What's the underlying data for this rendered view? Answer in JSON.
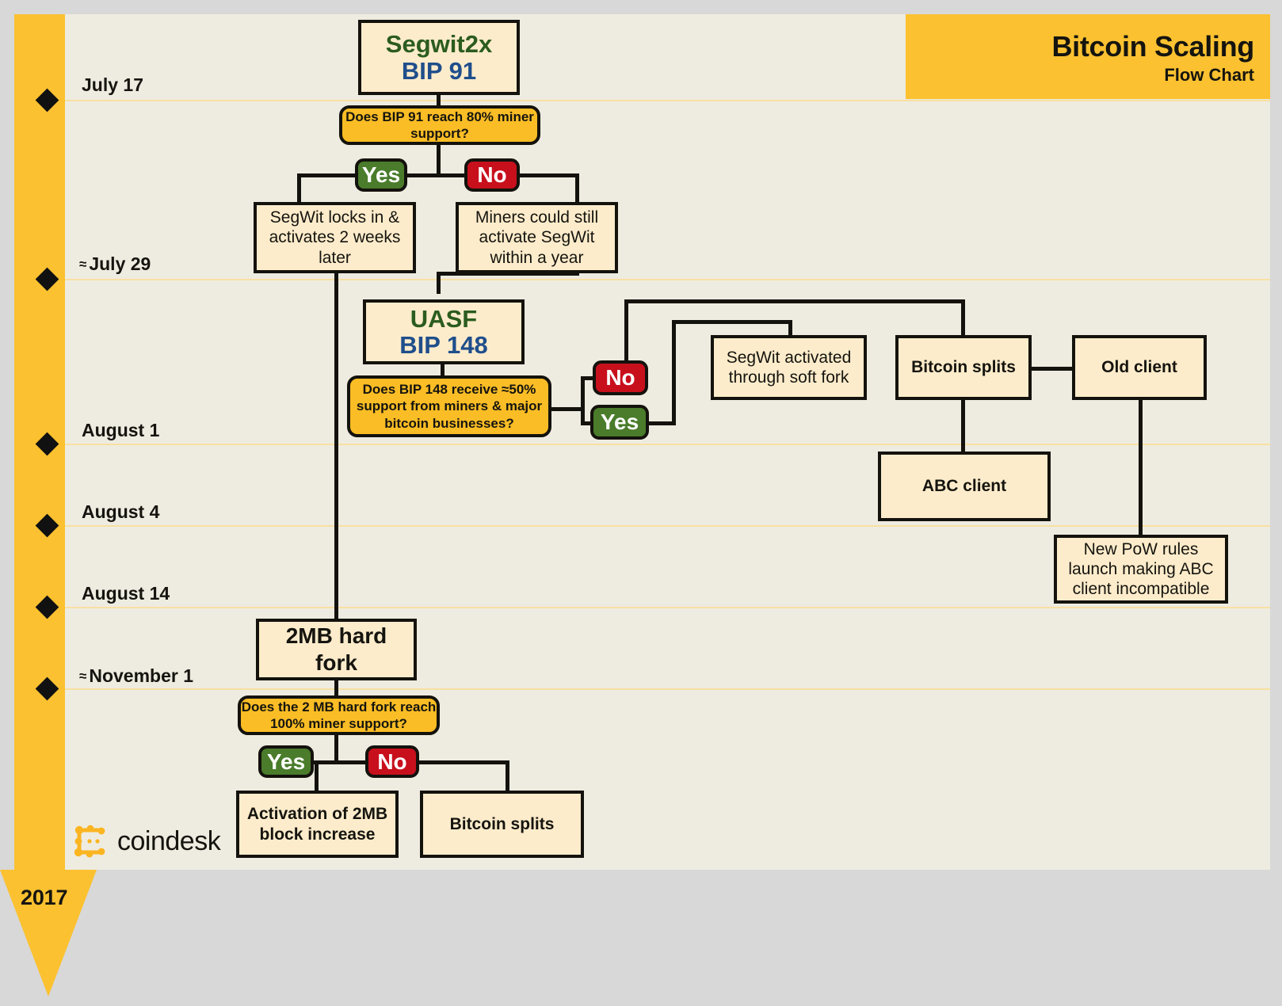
{
  "header": {
    "title": "Bitcoin Scaling",
    "subtitle": "Flow Chart"
  },
  "timeline": {
    "year": "2017",
    "dates": [
      {
        "approx": "",
        "label": "July 17"
      },
      {
        "approx": "≈",
        "label": "July 29"
      },
      {
        "approx": "",
        "label": "August 1"
      },
      {
        "approx": "",
        "label": "August 4"
      },
      {
        "approx": "",
        "label": "August 14"
      },
      {
        "approx": "≈",
        "label": "November 1"
      }
    ]
  },
  "brand": {
    "name": "coindesk",
    "logo_icon": "coindesk-dotted-square-icon",
    "accent": "#fbc130"
  },
  "colors": {
    "rail": "#fbc130",
    "canvas": "#eeece0",
    "node_fill": "#fdeccb",
    "decision_fill": "#fbbd25",
    "yes": "#4a7c2b",
    "no": "#c8101d",
    "title_green": "#2b5c1f",
    "title_blue": "#1f4e8c",
    "gridline": "#f8dfa2",
    "stroke": "#14120d"
  },
  "chart_data": {
    "type": "diagram",
    "title": "Bitcoin Scaling Flow Chart",
    "nodes": [
      {
        "id": "segwit2x",
        "kind": "title-node",
        "line1": "Segwit2x",
        "line2": "BIP 91"
      },
      {
        "id": "q_bip91",
        "kind": "decision",
        "text": "Does BIP 91 reach 80% miner support?"
      },
      {
        "id": "bip91_yes",
        "kind": "badge",
        "text": "Yes"
      },
      {
        "id": "bip91_no",
        "kind": "badge",
        "text": "No"
      },
      {
        "id": "segwit_locks",
        "kind": "node",
        "text": "SegWit locks in & activates 2 weeks later"
      },
      {
        "id": "miners_still",
        "kind": "node",
        "text": "Miners could still activate SegWit within a year"
      },
      {
        "id": "uasf",
        "kind": "title-node",
        "line1": "UASF",
        "line2": "BIP 148"
      },
      {
        "id": "q_bip148",
        "kind": "decision",
        "text": "Does BIP 148 receive ≈50% support from miners & major bitcoin businesses?"
      },
      {
        "id": "bip148_no",
        "kind": "badge",
        "text": "No"
      },
      {
        "id": "bip148_yes",
        "kind": "badge",
        "text": "Yes"
      },
      {
        "id": "segwit_soft",
        "kind": "node",
        "text": "SegWit activated through soft fork"
      },
      {
        "id": "btc_splits_top",
        "kind": "node",
        "text": "Bitcoin splits"
      },
      {
        "id": "old_client",
        "kind": "node",
        "text": "Old client"
      },
      {
        "id": "abc_client",
        "kind": "node",
        "text": "ABC client"
      },
      {
        "id": "new_pow",
        "kind": "node",
        "text": "New PoW rules launch making ABC client incompatible"
      },
      {
        "id": "hard_fork",
        "kind": "node",
        "text": "2MB hard fork"
      },
      {
        "id": "q_2mb",
        "kind": "decision",
        "text": "Does the 2 MB hard fork reach 100% miner support?"
      },
      {
        "id": "mb2_yes",
        "kind": "badge",
        "text": "Yes"
      },
      {
        "id": "mb2_no",
        "kind": "badge",
        "text": "No"
      },
      {
        "id": "activation_2mb",
        "kind": "node",
        "text": "Activation of 2MB block increase"
      },
      {
        "id": "btc_splits_bottom",
        "kind": "node",
        "text": "Bitcoin splits"
      }
    ],
    "edges": [
      {
        "from": "segwit2x",
        "to": "q_bip91"
      },
      {
        "from": "q_bip91",
        "to": "bip91_yes",
        "label": "Yes"
      },
      {
        "from": "q_bip91",
        "to": "bip91_no",
        "label": "No"
      },
      {
        "from": "bip91_yes",
        "to": "segwit_locks"
      },
      {
        "from": "bip91_no",
        "to": "miners_still"
      },
      {
        "from": "miners_still",
        "to": "uasf"
      },
      {
        "from": "uasf",
        "to": "q_bip148"
      },
      {
        "from": "q_bip148",
        "to": "bip148_no",
        "label": "No"
      },
      {
        "from": "q_bip148",
        "to": "bip148_yes",
        "label": "Yes"
      },
      {
        "from": "bip148_no",
        "to": "btc_splits_top"
      },
      {
        "from": "bip148_yes",
        "to": "segwit_soft"
      },
      {
        "from": "btc_splits_top",
        "to": "old_client"
      },
      {
        "from": "btc_splits_top",
        "to": "abc_client"
      },
      {
        "from": "old_client",
        "to": "new_pow"
      },
      {
        "from": "segwit_locks",
        "to": "hard_fork"
      },
      {
        "from": "hard_fork",
        "to": "q_2mb"
      },
      {
        "from": "q_2mb",
        "to": "mb2_yes",
        "label": "Yes"
      },
      {
        "from": "q_2mb",
        "to": "mb2_no",
        "label": "No"
      },
      {
        "from": "mb2_yes",
        "to": "activation_2mb"
      },
      {
        "from": "mb2_no",
        "to": "btc_splits_bottom"
      }
    ]
  },
  "nodes": {
    "segwit2x_l1": "Segwit2x",
    "segwit2x_l2": "BIP 91",
    "q_bip91": "Does BIP 91 reach 80% miner support?",
    "bip91_yes": "Yes",
    "bip91_no": "No",
    "segwit_locks": "SegWit locks in & activates 2 weeks later",
    "miners_still": "Miners could still activate SegWit within a year",
    "uasf_l1": "UASF",
    "uasf_l2": "BIP 148",
    "q_bip148": "Does BIP 148 receive ≈50% support from miners & major bitcoin businesses?",
    "bip148_no": "No",
    "bip148_yes": "Yes",
    "segwit_soft": "SegWit activated through soft fork",
    "btc_splits_top": "Bitcoin splits",
    "old_client": "Old client",
    "abc_client": "ABC client",
    "new_pow": "New PoW rules launch making ABC client incompatible",
    "hard_fork": "2MB hard fork",
    "q_2mb": "Does the 2 MB hard fork reach 100% miner support?",
    "mb2_yes": "Yes",
    "mb2_no": "No",
    "activation_2mb": "Activation of 2MB block increase",
    "btc_splits_bottom": "Bitcoin splits"
  }
}
